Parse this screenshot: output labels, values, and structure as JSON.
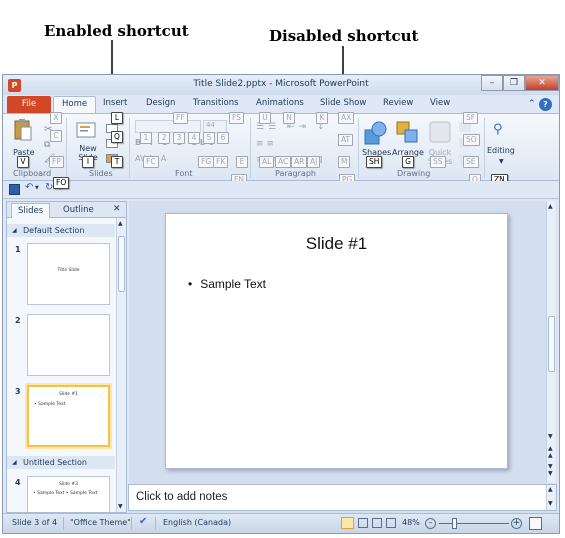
{
  "annotations": {
    "enabled": "Enabled shortcut",
    "disabled": "Disabled shortcut"
  },
  "window": {
    "title": "Title Slide2.pptx - Microsoft PowerPoint",
    "app_icon": "P",
    "controls": {
      "minimize": "–",
      "restore": "❐",
      "close": "✕"
    }
  },
  "tabs": [
    "File",
    "Home",
    "Insert",
    "Design",
    "Transitions",
    "Animations",
    "Slide Show",
    "Review",
    "View"
  ],
  "ribbon": {
    "groups": [
      "Clipboard",
      "Slides",
      "Font",
      "Paragraph",
      "Drawing",
      "Editing"
    ],
    "buttons": {
      "paste": "Paste",
      "new_slide": "New Slide",
      "font_size": "44",
      "shapes": "Shapes",
      "arrange": "Arrange",
      "quick_styles": "Quick Styles",
      "editing": "Editing"
    },
    "keytips": {
      "X": "X",
      "C": "C",
      "FP": "FP",
      "V": "V",
      "I": "I",
      "L": "L",
      "Q": "Q",
      "T": "T",
      "FF": "FF",
      "FS": "FS",
      "1": "1",
      "2": "2",
      "3": "3",
      "4": "4",
      "5": "5",
      "6": "6",
      "FC": "FC",
      "FG": "FG",
      "FK": "FK",
      "E": "E",
      "FN": "FN",
      "U": "U",
      "N": "N",
      "K": "K",
      "AX": "AX",
      "AT": "AT",
      "AL": "AL",
      "AC": "AC",
      "AR": "AR",
      "AJ": "AJ",
      "M": "M",
      "PG": "PG",
      "SH": "SH",
      "G": "G",
      "S": "S",
      "SF": "SF",
      "SO": "SO",
      "SE": "SE",
      "SS": "SS",
      "O": "O",
      "ZN": "ZN",
      "FO": "FO"
    }
  },
  "left_pane": {
    "tabs": [
      "Slides",
      "Outline"
    ],
    "close": "✕",
    "sections": [
      "Default Section",
      "Untitled Section"
    ],
    "slides": [
      {
        "num": "1",
        "title": "Title Slide",
        "body": ""
      },
      {
        "num": "2",
        "title": "",
        "body": ""
      },
      {
        "num": "3",
        "title": "Slide #1",
        "body": "• Sample Text"
      },
      {
        "num": "4",
        "title": "Slide #3",
        "body": "• Sample Text     • Sample Text"
      }
    ]
  },
  "slide": {
    "title": "Slide #1",
    "bullet": "Sample Text"
  },
  "notes_placeholder": "Click to add notes",
  "status": {
    "slide_pos": "Slide 3 of 4",
    "theme": "\"Office Theme\"",
    "language": "English (Canada)",
    "zoom": "48%",
    "zoom_minus": "–",
    "zoom_plus": "+"
  }
}
